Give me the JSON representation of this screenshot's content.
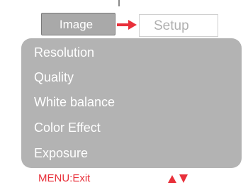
{
  "tabs": {
    "active": "Image",
    "inactive": "Setup"
  },
  "menu": {
    "items": [
      "Resolution",
      "Quality",
      "White balance",
      "Color Effect",
      "Exposure"
    ]
  },
  "footer": {
    "exit_label": "MENU:Exit"
  },
  "icons": {
    "tab_arrow": "arrow-right-icon",
    "navigation": "up-down-arrows-icon"
  },
  "colors": {
    "accent": "#e8303a",
    "menu_background": "#b3b3b3",
    "active_tab": "#a9a9a9"
  }
}
